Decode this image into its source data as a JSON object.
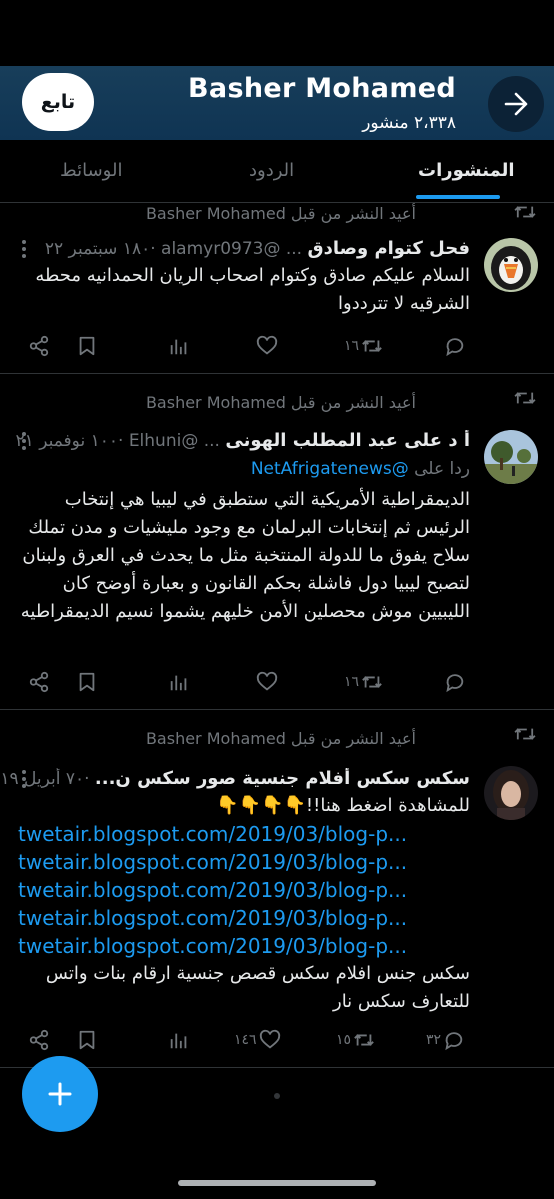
{
  "header": {
    "name": "Basher Mohamed",
    "post_count": "٢،٣٣٨ منشور",
    "follow_label": "تابع"
  },
  "tabs": [
    {
      "label": "المنشورات",
      "active": true
    },
    {
      "label": "الردود",
      "active": false
    },
    {
      "label": "الوسائط",
      "active": false
    }
  ],
  "retweet_label": "أعيد النشر من قبل Basher Mohamed",
  "posts": [
    {
      "retweet_label": "أعيد النشر من قبل Basher Mohamed",
      "display_name": "فحل كتوام وصادق",
      "handle_time": "... @alamyr0973 ·١٨٠ سبتمبر ٢٢",
      "body": "السلام عليكم  صادق وكتوام  اصحاب الريان الحمدانيه محطه الشرقيه لا تترددوا",
      "retweets": "١٦",
      "likes": "",
      "replies": ""
    },
    {
      "retweet_label": "أعيد النشر من قبل Basher Mohamed",
      "display_name": "أ د على عبد المطلب الهونى",
      "handle_time": "... @Elhuni ·١٠٠ نوفمبر ٢١",
      "reply_prefix": "ردا على",
      "reply_to": "@NetAfrigatenews",
      "body": "الديمقراطية الأمريكية التي ستطبق في ليبيا هي إنتخاب الرئيس ثم إنتخابات البرلمان مع وجود مليشيات و مدن تملك سلاح يفوق ما للدولة المنتخبة مثل ما يحدث في العرق ولبنان  لتصبح ليبيا دول فاشلة بحكم القانون و بعبارة أوضح كان الليبيين موش محصلين الأمن خليهم يشموا نسيم الديمقراطيه",
      "retweets": "١٦",
      "likes": "",
      "replies": ""
    },
    {
      "retweet_label": "أعيد النشر من قبل Basher Mohamed",
      "display_name": "سكس سكس أفلام جنسية صور سكس ن...",
      "handle_time": "·٧٠ أبريل ١٩",
      "body_top": "للمشاهدة اضغط هنا!!👇👇👇👇",
      "links": [
        "twetair.blogspot.com/2019/03/blog-p...",
        "twetair.blogspot.com/2019/03/blog-p...",
        "twetair.blogspot.com/2019/03/blog-p...",
        "twetair.blogspot.com/2019/03/blog-p...",
        "twetair.blogspot.com/2019/03/blog-p..."
      ],
      "body_bottom": "سكس جنس افلام سكس قصص جنسية ارقام بنات واتس للتعارف سكس نار",
      "retweets": "١٥",
      "likes": "١٤٦",
      "replies": "٣٢"
    }
  ],
  "colors": {
    "accent": "#1d9bf0",
    "header_bg": "#0f3453",
    "muted": "#71767b"
  },
  "icons": [
    "back-arrow-icon",
    "retweet-icon",
    "more-dots-icon",
    "share-icon",
    "bookmark-icon",
    "views-icon",
    "like-icon",
    "reply-icon",
    "plus-icon"
  ]
}
